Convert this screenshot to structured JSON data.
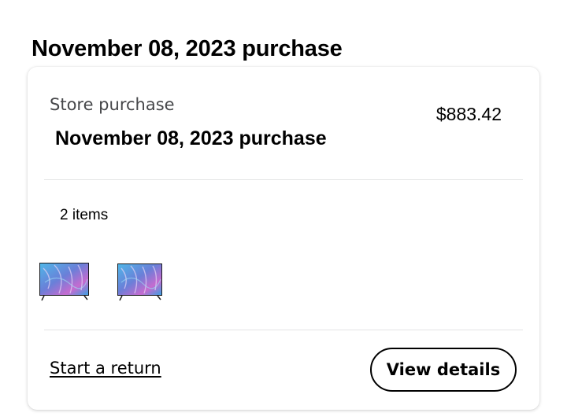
{
  "header": {
    "title": "November 08, 2023 purchase"
  },
  "order": {
    "store_label": "Store purchase",
    "price": "$883.42",
    "purchase_title": "November 08, 2023 purchase",
    "item_count": "2 items",
    "items": [
      {
        "icon": "tv-product-image"
      },
      {
        "icon": "tv-product-image"
      }
    ],
    "actions": {
      "return_label": "Start a return",
      "details_label": "View details"
    }
  },
  "colors": {
    "text": "#000000",
    "muted": "#46474a",
    "divider": "#e3e4e5",
    "tv_screen_a": "#5b8fd6",
    "tv_screen_b": "#c070c8"
  }
}
